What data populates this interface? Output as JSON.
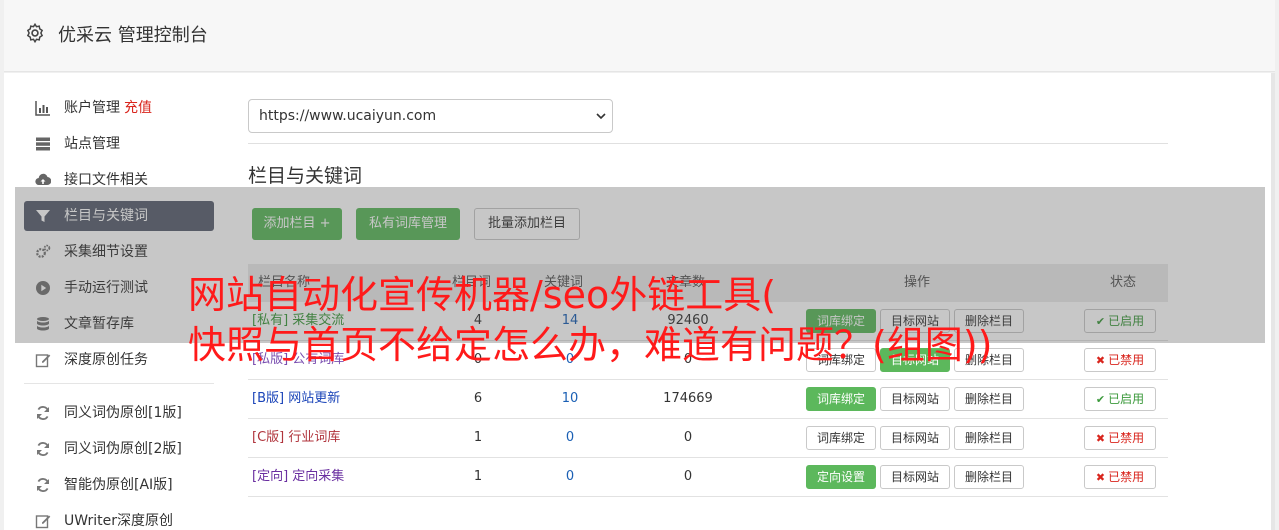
{
  "header": {
    "title": "优采云 管理控制台"
  },
  "sidebar": {
    "items": [
      {
        "label": "账户管理",
        "extra": "充值",
        "icon": "bar-chart-icon"
      },
      {
        "label": "站点管理",
        "icon": "server-icon"
      },
      {
        "label": "接口文件相关",
        "icon": "cloud-upload-icon"
      },
      {
        "label": "栏目与关键词",
        "icon": "filter-icon",
        "active": true
      },
      {
        "label": "采集细节设置",
        "icon": "gears-icon"
      },
      {
        "label": "手动运行测试",
        "icon": "play-circle-icon"
      },
      {
        "label": "文章暂存库",
        "icon": "database-icon"
      },
      {
        "label": "深度原创任务",
        "icon": "edit-icon"
      }
    ],
    "items2": [
      {
        "label": "同义词伪原创[1版]",
        "icon": "refresh-icon"
      },
      {
        "label": "同义词伪原创[2版]",
        "icon": "refresh-icon"
      },
      {
        "label": "智能伪原创[AI版]",
        "icon": "refresh-icon"
      },
      {
        "label": "UWriter深度原创",
        "icon": "edit-icon"
      }
    ]
  },
  "site_select": {
    "value": "https://www.ucaiyun.com"
  },
  "section_title": "栏目与关键词",
  "toolbar": {
    "add_column": "添加栏目 +",
    "private_lib": "私有词库管理",
    "batch_add": "批量添加栏目"
  },
  "table": {
    "headers": [
      "栏目名称",
      "栏目词",
      "关键词",
      "文章数",
      "操作",
      "状态"
    ],
    "rows": [
      {
        "tag": "[私有]",
        "name": "采集交流",
        "tag_color": "#3c9a3c",
        "c1": "4",
        "c2": "14",
        "c3": "92460",
        "bind_label": "词库绑定",
        "bind_green": true,
        "target": "目标网站",
        "target_green": false,
        "delete": "删除栏目",
        "status": "已启用",
        "status_on": true
      },
      {
        "tag": "[私版]",
        "name": "公有词库",
        "tag_color": "#7a4fb0",
        "c1": "0",
        "c2": "0",
        "c3": "0",
        "bind_label": "词库绑定",
        "bind_green": false,
        "target": "目标网站",
        "target_green": true,
        "delete": "删除栏目",
        "status": "已禁用",
        "status_on": false
      },
      {
        "tag": "[B版]",
        "name": "网站更新",
        "tag_color": "#1a44b8",
        "c1": "6",
        "c2": "10",
        "c3": "174669",
        "bind_label": "词库绑定",
        "bind_green": true,
        "target": "目标网站",
        "target_green": false,
        "delete": "删除栏目",
        "status": "已启用",
        "status_on": true
      },
      {
        "tag": "[C版]",
        "name": "行业词库",
        "tag_color": "#b0343c",
        "c1": "1",
        "c2": "0",
        "c3": "0",
        "bind_label": "词库绑定",
        "bind_green": false,
        "target": "目标网站",
        "target_green": false,
        "delete": "删除栏目",
        "status": "已禁用",
        "status_on": false
      },
      {
        "tag": "[定向]",
        "name": "定向采集",
        "tag_color": "#6a2fa0",
        "c1": "1",
        "c2": "0",
        "c3": "0",
        "bind_label": "定向设置",
        "bind_green": true,
        "target": "目标网站",
        "target_green": false,
        "delete": "删除栏目",
        "status": "已禁用",
        "status_on": false
      }
    ]
  },
  "overlay_text": {
    "line1": "网站自动化宣传机器/seo外链工具(",
    "line2": "快照与首页不给定怎么办，难道有问题？(组图))"
  },
  "colors": {
    "green": "#5cb85c",
    "active_nav": "#5a6170",
    "red": "#ff1a1a"
  }
}
